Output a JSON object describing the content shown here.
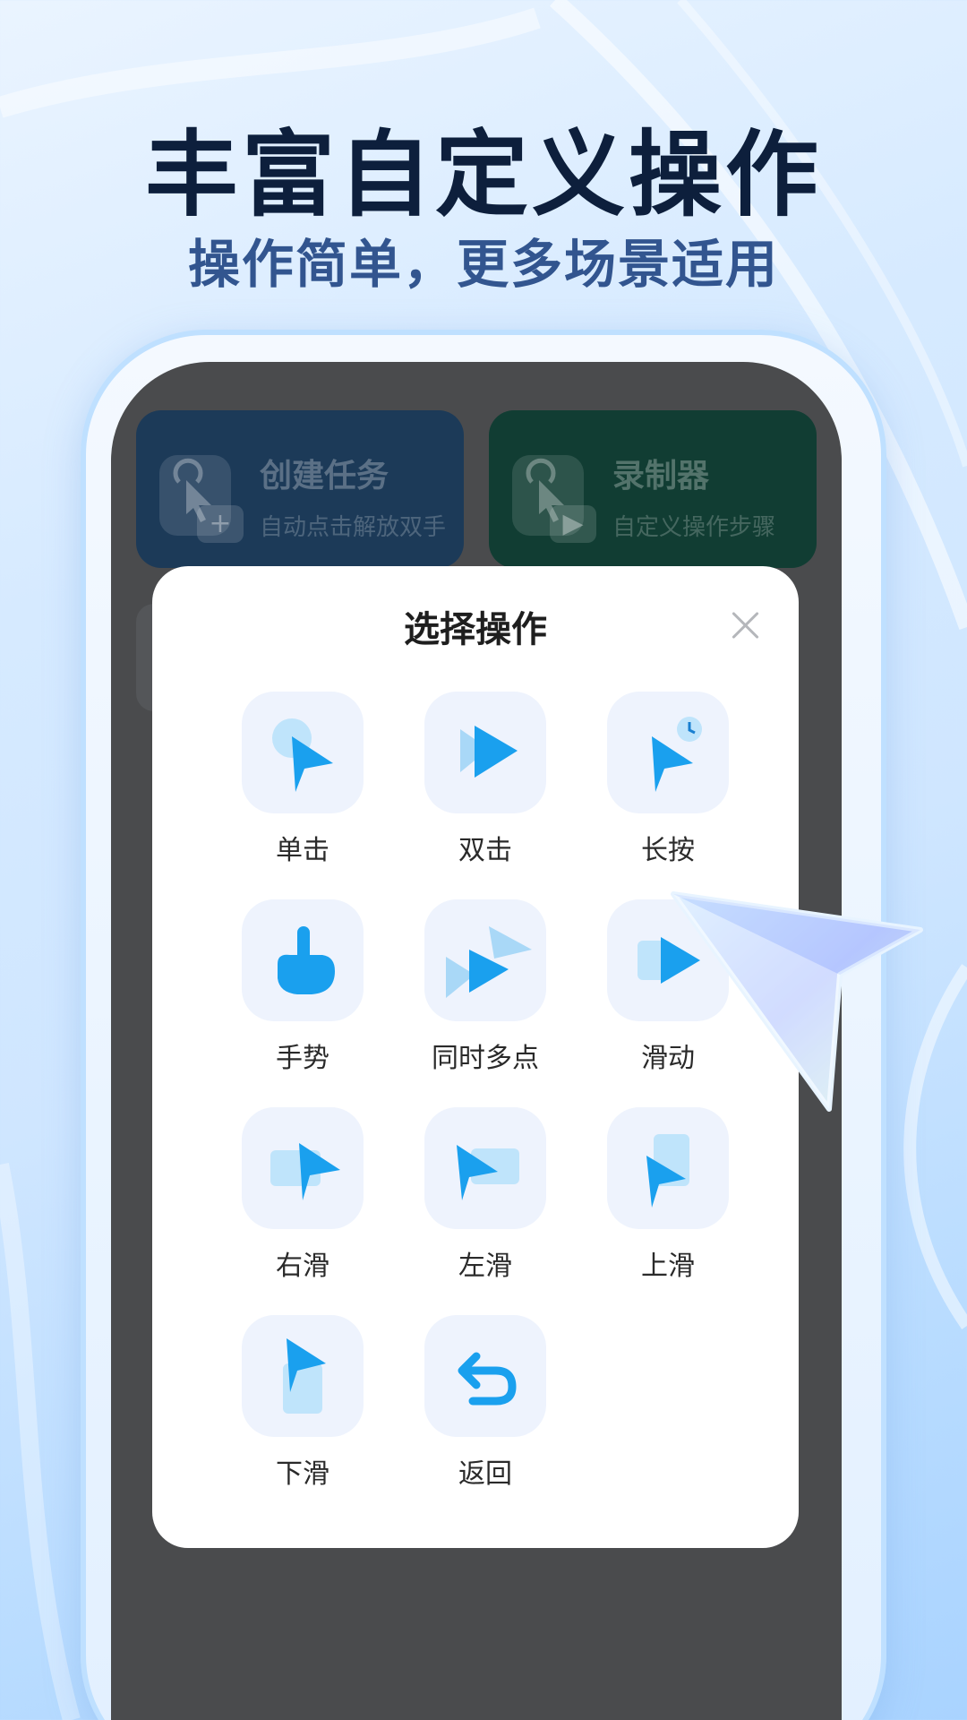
{
  "hero": {
    "title": "丰富自定义操作",
    "subtitle": "操作简单，更多场景适用"
  },
  "background_cards": [
    {
      "title": "创建任务",
      "subtitle": "自动点击解放双手",
      "icon": "tap-add-icon",
      "color": "#1c3a58"
    },
    {
      "title": "录制器",
      "subtitle": "自定义操作步骤",
      "icon": "tap-video-icon",
      "color": "#113d33"
    }
  ],
  "modal": {
    "title": "选择操作",
    "close_icon": "close-icon",
    "operations": [
      {
        "label": "单击",
        "icon": "single-tap-icon"
      },
      {
        "label": "双击",
        "icon": "double-tap-icon"
      },
      {
        "label": "长按",
        "icon": "long-press-icon"
      },
      {
        "label": "手势",
        "icon": "gesture-hand-icon"
      },
      {
        "label": "同时多点",
        "icon": "multi-point-icon"
      },
      {
        "label": "滑动",
        "icon": "swipe-icon"
      },
      {
        "label": "右滑",
        "icon": "swipe-right-icon"
      },
      {
        "label": "左滑",
        "icon": "swipe-left-icon"
      },
      {
        "label": "上滑",
        "icon": "swipe-up-icon"
      },
      {
        "label": "下滑",
        "icon": "swipe-down-icon"
      },
      {
        "label": "返回",
        "icon": "back-icon"
      }
    ]
  },
  "colors": {
    "accent": "#1aa0ee",
    "headline": "#0d1f3c",
    "subline": "#32558f",
    "tile": "#eef3fd"
  }
}
